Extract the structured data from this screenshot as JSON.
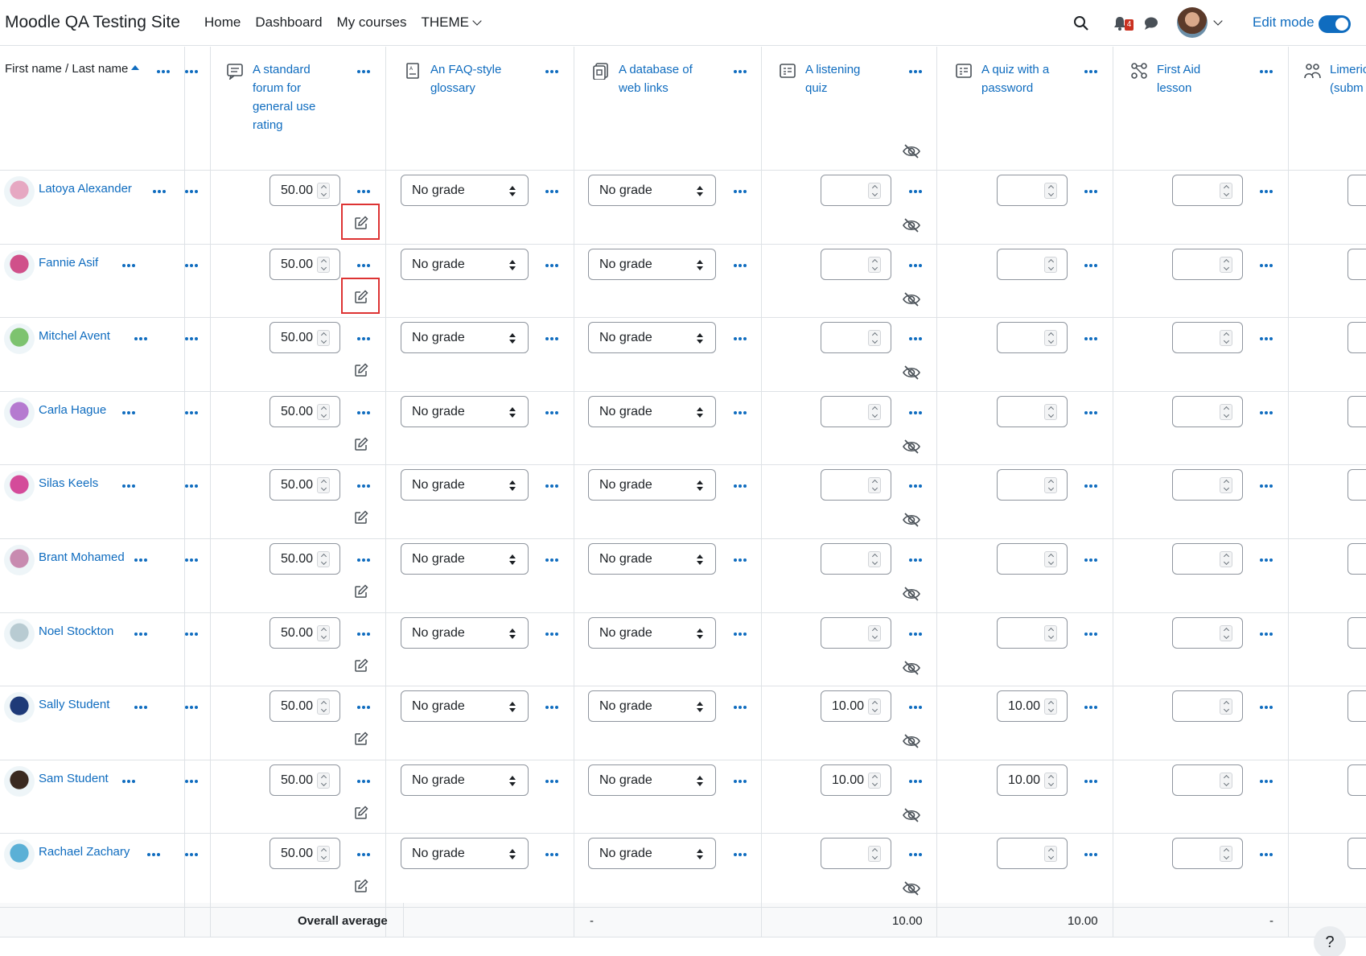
{
  "nav": {
    "brand": "Moodle QA Testing Site",
    "links": [
      "Home",
      "Dashboard",
      "My courses"
    ],
    "theme": "THEME",
    "notif_count": "4",
    "edit_mode": "Edit mode"
  },
  "table": {
    "name_header": "First name / Last name",
    "columns": [
      {
        "title": [
          "A standard",
          "forum for",
          "general use",
          "rating"
        ],
        "icon": "forum-icon"
      },
      {
        "title": [
          "An FAQ-style",
          "glossary"
        ],
        "icon": "glossary-icon"
      },
      {
        "title": [
          "A database of",
          "web links"
        ],
        "icon": "database-icon"
      },
      {
        "title": [
          "A listening",
          "quiz"
        ],
        "icon": "quiz-icon"
      },
      {
        "title": [
          "A quiz with a",
          "password"
        ],
        "icon": "quiz-icon"
      },
      {
        "title": [
          "First Aid",
          "lesson"
        ],
        "icon": "lesson-icon"
      },
      {
        "title": [
          "Limeric",
          "(subm"
        ],
        "icon": "workshop-icon"
      }
    ],
    "rows": [
      {
        "name": "Latoya Alexander",
        "forum": "50.00",
        "glossary": "No grade",
        "database": "No grade",
        "listening": "",
        "password": "",
        "lesson": ""
      },
      {
        "name": "Fannie Asif",
        "forum": "50.00",
        "glossary": "No grade",
        "database": "No grade",
        "listening": "",
        "password": "",
        "lesson": ""
      },
      {
        "name": "Mitchel Avent",
        "forum": "50.00",
        "glossary": "No grade",
        "database": "No grade",
        "listening": "",
        "password": "",
        "lesson": ""
      },
      {
        "name": "Carla Hague",
        "forum": "50.00",
        "glossary": "No grade",
        "database": "No grade",
        "listening": "",
        "password": "",
        "lesson": ""
      },
      {
        "name": "Silas Keels",
        "forum": "50.00",
        "glossary": "No grade",
        "database": "No grade",
        "listening": "",
        "password": "",
        "lesson": ""
      },
      {
        "name": "Brant Mohamed",
        "forum": "50.00",
        "glossary": "No grade",
        "database": "No grade",
        "listening": "",
        "password": "",
        "lesson": ""
      },
      {
        "name": "Noel Stockton",
        "forum": "50.00",
        "glossary": "No grade",
        "database": "No grade",
        "listening": "",
        "password": "",
        "lesson": ""
      },
      {
        "name": "Sally Student",
        "forum": "50.00",
        "glossary": "No grade",
        "database": "No grade",
        "listening": "10.00",
        "password": "10.00",
        "lesson": ""
      },
      {
        "name": "Sam Student",
        "forum": "50.00",
        "glossary": "No grade",
        "database": "No grade",
        "listening": "10.00",
        "password": "10.00",
        "lesson": ""
      },
      {
        "name": "Rachael Zachary",
        "forum": "50.00",
        "glossary": "No grade",
        "database": "No grade",
        "listening": "",
        "password": "",
        "lesson": ""
      }
    ],
    "avg_label": "Overall average",
    "averages": {
      "database": "-",
      "listening": "10.00",
      "password": "10.00",
      "lesson": "-"
    },
    "avatar_colors": [
      "#e6a8c2",
      "#d0508a",
      "#7dc36f",
      "#b57ad0",
      "#d44b9a",
      "#c88bb0",
      "#b8cbd2",
      "#1e3a78",
      "#3b2a20",
      "#5bb0d6"
    ]
  },
  "help": "?"
}
